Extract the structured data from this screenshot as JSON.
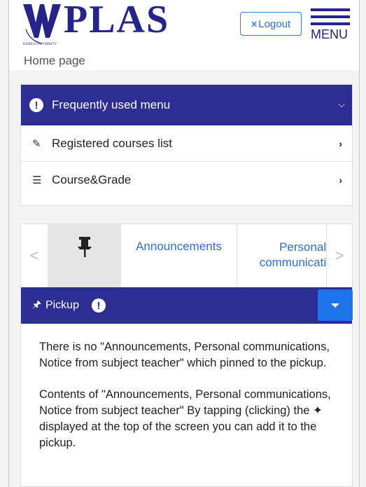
{
  "header": {
    "logo_text": "PLAS",
    "logo_sub": "KOREA UNIVERSITY",
    "logout_label": "Logout",
    "menu_label": "MENU",
    "breadcrumb": "Home page"
  },
  "favorites": {
    "title": "Frequently used menu",
    "items": [
      {
        "label": "Registered courses list",
        "icon": "pencil-icon"
      },
      {
        "label": "Course&Grade",
        "icon": "list-icon"
      }
    ]
  },
  "tabs": {
    "prev": "<",
    "next": ">",
    "items": [
      "Announcements",
      "Personal",
      "communicati"
    ]
  },
  "pickup": {
    "title": "Pickup",
    "paragraph1": "There is no \"Announcements, Personal communications, Notice from subject teacher\" which pinned to the pickup.",
    "paragraph2": "Contents of \"Announcements, Personal communications, Notice from subject teacher\" By tapping (clicking) the ✦ displayed at the top of the screen you can add it to the pickup."
  },
  "colors": {
    "brand": "#2d2d92",
    "link": "#2f6fd0",
    "button": "#1e73e8"
  }
}
